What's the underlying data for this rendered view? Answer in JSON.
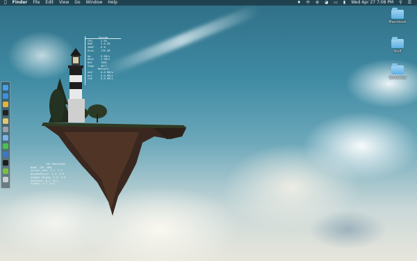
{
  "menubar": {
    "app_name": "Finder",
    "menus": [
      "File",
      "Edit",
      "View",
      "Go",
      "Window",
      "Help"
    ],
    "status_icons": [
      "dropbox-icon",
      "time-machine-icon",
      "bluetooth-icon",
      "wifi-icon",
      "airplay-icon",
      "volume-icon"
    ],
    "datetime": "Wed Apr 27  7:08 PM"
  },
  "desktop_icons": [
    {
      "label": "Macintosh",
      "icon": "folder-icon"
    },
    {
      "label": "Stuff",
      "icon": "folder-icon"
    },
    {
      "label": "Screenies",
      "icon": "folder-icon"
    }
  ],
  "dock": {
    "items": [
      "finder",
      "app-store",
      "chrome",
      "terminal",
      "adium",
      "system-preferences",
      "itunes",
      "spotify",
      "xcode",
      "activity-monitor",
      "utorrent",
      "trash"
    ],
    "colors": [
      "#4a9ee8",
      "#3f8fe0",
      "#e4b33a",
      "#222222",
      "#e6c66a",
      "#9aa0a6",
      "#7bb3e8",
      "#4cc04a",
      "#3b78c8",
      "#1d1d1d",
      "#7ac043",
      "#c9cdd0"
    ]
  },
  "system_monitor": {
    "section1_title": "System",
    "section1_rows": [
      {
        "label": "CPU",
        "value": "2.9%"
      },
      {
        "label": "RAM",
        "value": "2.8 GB"
      },
      {
        "label": "SWAP",
        "value": "0 B"
      },
      {
        "label": "Disk",
        "value": "178 GB"
      }
    ],
    "section2_rows": [
      {
        "label": "Up",
        "value": "0 KB/s"
      },
      {
        "label": "Down",
        "value": "2 KB/s"
      },
      {
        "label": "Bat",
        "value": "100%"
      },
      {
        "label": "Temp",
        "value": "48°C"
      }
    ],
    "section3_title": "Network",
    "section3_rows": [
      {
        "label": "en0",
        "value": "0.0 KB/s"
      },
      {
        "label": "en1",
        "value": "0.0 KB/s"
      },
      {
        "label": "lo0",
        "value": "0.0 KB/s"
      }
    ]
  },
  "process_monitor": {
    "title": "TOP PROCESSES",
    "headers": [
      "NAME",
      "CPU",
      "MEM"
    ],
    "rows": [
      {
        "name": "kernel_task",
        "cpu": "3.1",
        "mem": "1.2"
      },
      {
        "name": "WindowServer",
        "cpu": "2.4",
        "mem": "0.9"
      },
      {
        "name": "Google Chrome",
        "cpu": "1.8",
        "mem": "4.6"
      },
      {
        "name": "GeekTool",
        "cpu": "0.7",
        "mem": "0.3"
      },
      {
        "name": "Finder",
        "cpu": "0.2",
        "mem": "0.8"
      }
    ]
  }
}
